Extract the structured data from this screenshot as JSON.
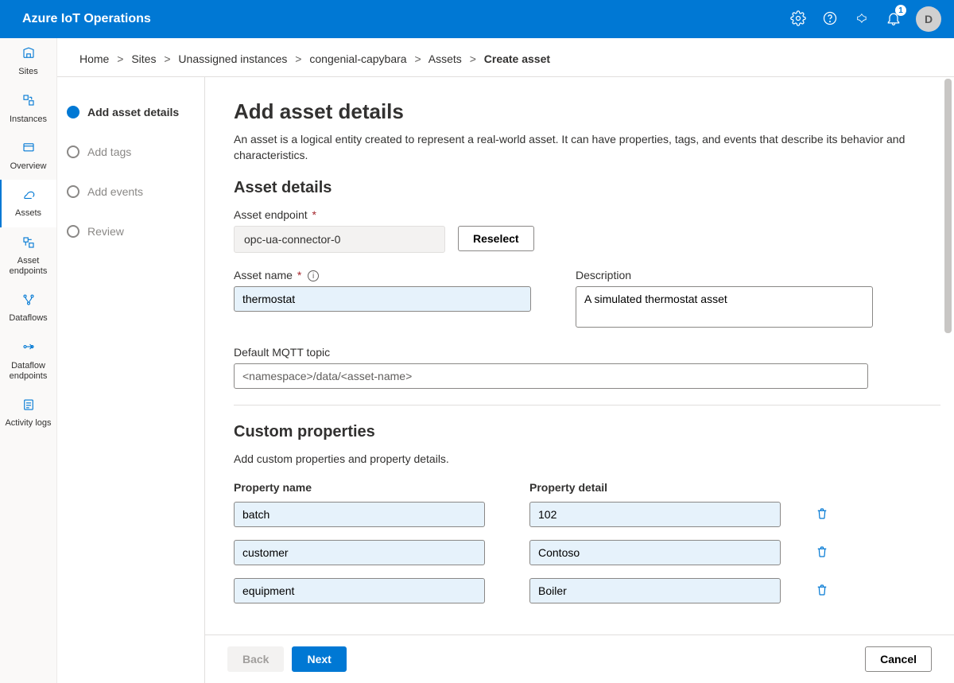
{
  "header": {
    "title": "Azure IoT Operations",
    "notification_count": "1",
    "avatar_initial": "D"
  },
  "leftnav": {
    "items": [
      {
        "key": "sites",
        "label": "Sites"
      },
      {
        "key": "instances",
        "label": "Instances"
      },
      {
        "key": "overview",
        "label": "Overview"
      },
      {
        "key": "assets",
        "label": "Assets",
        "active": true
      },
      {
        "key": "asset-endpoints",
        "label": "Asset endpoints"
      },
      {
        "key": "dataflows",
        "label": "Dataflows"
      },
      {
        "key": "dataflow-endpoints",
        "label": "Dataflow endpoints"
      },
      {
        "key": "activity-logs",
        "label": "Activity logs"
      }
    ]
  },
  "breadcrumb": {
    "items": [
      "Home",
      "Sites",
      "Unassigned instances",
      "congenial-capybara",
      "Assets"
    ],
    "current": "Create asset"
  },
  "steps": [
    {
      "label": "Add asset details",
      "active": true
    },
    {
      "label": "Add tags"
    },
    {
      "label": "Add events"
    },
    {
      "label": "Review"
    }
  ],
  "content": {
    "title": "Add asset details",
    "intro": "An asset is a logical entity created to represent a real-world asset. It can have properties, tags, and events that describe its behavior and characteristics.",
    "asset_details_heading": "Asset details",
    "endpoint_label": "Asset endpoint",
    "endpoint_value": "opc-ua-connector-0",
    "reselect_label": "Reselect",
    "name_label": "Asset name",
    "name_value": "thermostat",
    "desc_label": "Description",
    "desc_value": "A simulated thermostat asset",
    "mqtt_label": "Default MQTT topic",
    "mqtt_placeholder": "<namespace>/data/<asset-name>",
    "custom_heading": "Custom properties",
    "custom_intro": "Add custom properties and property details.",
    "prop_name_header": "Property name",
    "prop_detail_header": "Property detail",
    "properties": [
      {
        "name": "batch",
        "detail": "102"
      },
      {
        "name": "customer",
        "detail": "Contoso"
      },
      {
        "name": "equipment",
        "detail": "Boiler"
      }
    ]
  },
  "footer": {
    "back_label": "Back",
    "next_label": "Next",
    "cancel_label": "Cancel"
  }
}
